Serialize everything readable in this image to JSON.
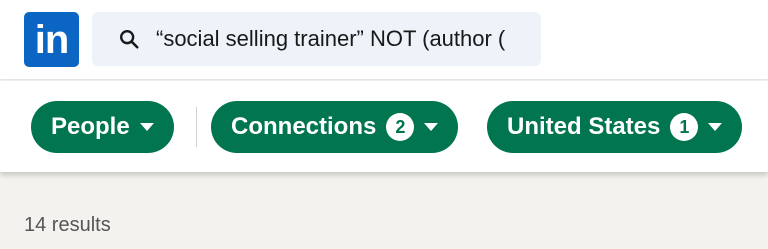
{
  "header": {
    "logo_text": "in",
    "search": {
      "icon": "search-icon",
      "value": "“social selling trainer” NOT (author ("
    }
  },
  "filters": [
    {
      "label": "People",
      "count": null
    },
    {
      "label": "Connections",
      "count": "2"
    },
    {
      "label": "United States",
      "count": "1"
    }
  ],
  "results": {
    "text": "14 results"
  },
  "colors": {
    "brand": "#0a66c2",
    "pill_bg": "#01754f",
    "search_bg": "#edf3f8"
  }
}
